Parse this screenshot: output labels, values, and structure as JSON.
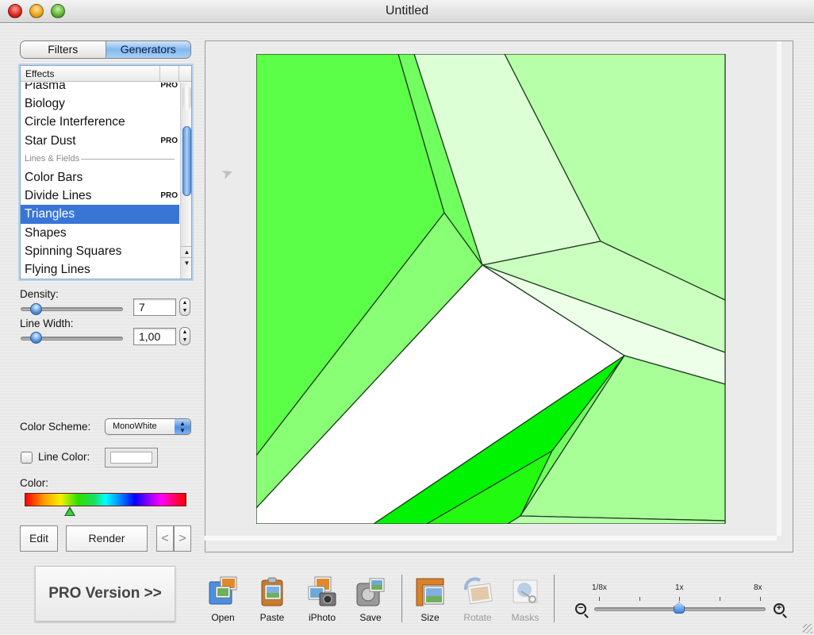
{
  "window": {
    "title": "Untitled",
    "controls": [
      "close",
      "minimize",
      "zoom"
    ]
  },
  "mode_tabs": [
    {
      "label": "Filters",
      "selected": false
    },
    {
      "label": "Generators",
      "selected": true
    }
  ],
  "effects_list": {
    "header": "Effects",
    "items": [
      {
        "label": "Plasma",
        "badge": "PRO",
        "type": "item"
      },
      {
        "label": "Biology",
        "badge": "",
        "type": "item"
      },
      {
        "label": "Circle Interference",
        "badge": "",
        "type": "item"
      },
      {
        "label": "Star Dust",
        "badge": "PRO",
        "type": "item"
      },
      {
        "label": "Lines & Fields",
        "badge": "",
        "type": "section"
      },
      {
        "label": "Color Bars",
        "badge": "",
        "type": "item"
      },
      {
        "label": "Divide Lines",
        "badge": "PRO",
        "type": "item"
      },
      {
        "label": "Triangles",
        "badge": "",
        "type": "item",
        "selected": true
      },
      {
        "label": "Shapes",
        "badge": "",
        "type": "item"
      },
      {
        "label": "Spinning Squares",
        "badge": "",
        "type": "item"
      },
      {
        "label": "Flying Lines",
        "badge": "",
        "type": "item"
      }
    ],
    "scroll_up": "▲",
    "scroll_down": "▼"
  },
  "params": {
    "density": {
      "label": "Density:",
      "value": "7",
      "slider_fraction": 0.1
    },
    "line_width": {
      "label": "Line Width:",
      "value": "1,00",
      "slider_fraction": 0.1
    },
    "stepper_glyph": "▲\n▼"
  },
  "color_scheme": {
    "label": "Color Scheme:",
    "value": "MonoWhite",
    "arrows": "▲▼"
  },
  "line_color": {
    "label": "Line Color:",
    "checked": false,
    "swatch": "#ffffff"
  },
  "color": {
    "label": "Color:",
    "hue_fraction": 0.28,
    "accent": "#39d13a"
  },
  "buttons": {
    "edit": "Edit",
    "render": "Render",
    "prev": "<",
    "next": ">",
    "pro": "PRO Version >>"
  },
  "toolbar": [
    {
      "label": "Open",
      "icon": "open-icon",
      "enabled": true
    },
    {
      "label": "Paste",
      "icon": "paste-icon",
      "enabled": true
    },
    {
      "label": "iPhoto",
      "icon": "iphoto-icon",
      "enabled": true
    },
    {
      "label": "Save",
      "icon": "save-icon",
      "enabled": true
    },
    {
      "label": "Size",
      "icon": "size-icon",
      "enabled": true
    },
    {
      "label": "Rotate",
      "icon": "rotate-icon",
      "enabled": false
    },
    {
      "label": "Masks",
      "icon": "masks-icon",
      "enabled": false
    }
  ],
  "zoom": {
    "labels": [
      "1/8x",
      "1x",
      "8x"
    ],
    "value": "1x",
    "zoom_out_glyph": "−",
    "zoom_in_glyph": "+"
  },
  "artwork": {
    "effect": "Triangles",
    "line_color": "#1f3f1f",
    "colors": {
      "bright": "#5cff47",
      "mid": "#88ff75",
      "pale": "#ddffd6",
      "light": "#b8ffaa",
      "lighter": "#caffbf",
      "palest": "#edffe9",
      "white": "#ffffff",
      "vivid": "#00f300",
      "vivid2": "#22fa10",
      "soft": "#a8ff98",
      "strip": "#72ff60"
    }
  }
}
